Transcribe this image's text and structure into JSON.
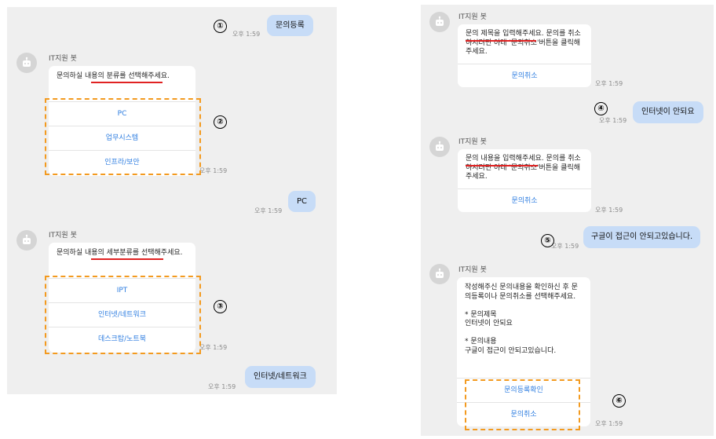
{
  "bot_name": "IT지원 봇",
  "time": "오후 1:59",
  "icons": {
    "avatar": "robot-icon"
  },
  "colors": {
    "user_bubble": "#c7dcf7",
    "button_text": "#2d7de0",
    "highlight_box": "#f39a1f",
    "underline": "#e02222"
  },
  "left": {
    "user1": "문의등록",
    "bot1": {
      "message": "문의하실 내용의 분류를 선택해주세요.",
      "options": [
        "PC",
        "업무시스템",
        "인프라/보안"
      ]
    },
    "user2": "PC",
    "bot2": {
      "message": "문의하실 내용의 세부분류를 선택해주세요.",
      "options": [
        "IPT",
        "인터넷/네트워크",
        "데스크탑/노트북"
      ]
    },
    "user3": "인터넷/네트워크"
  },
  "right": {
    "bot1": {
      "message": "문의 제목을 입력해주세요. 문의를 취소하시려면 아래 '문의취소'버튼을 클릭해주세요.",
      "button": "문의취소"
    },
    "user1": "인터넷이 안되요",
    "bot2": {
      "message": "문의 내용을 입력해주세요. 문의를 취소하시려면 아래 '문의취소'버튼을 클릭해주세요.",
      "button": "문의취소"
    },
    "user2": "구글이 접근이 안되고있습니다.",
    "bot3": {
      "message": "작성해주신 문의내용을 확인하신 후 문의등록이나 문의취소를 선택해주세요.\n\n* 문의제목\n인터넷이 안되요\n\n* 문의내용\n구글이 접근이 안되고있습니다.",
      "options": [
        "문의등록확인",
        "문의취소"
      ]
    }
  },
  "step_markers": [
    "①",
    "②",
    "③",
    "④",
    "⑤",
    "⑥"
  ]
}
